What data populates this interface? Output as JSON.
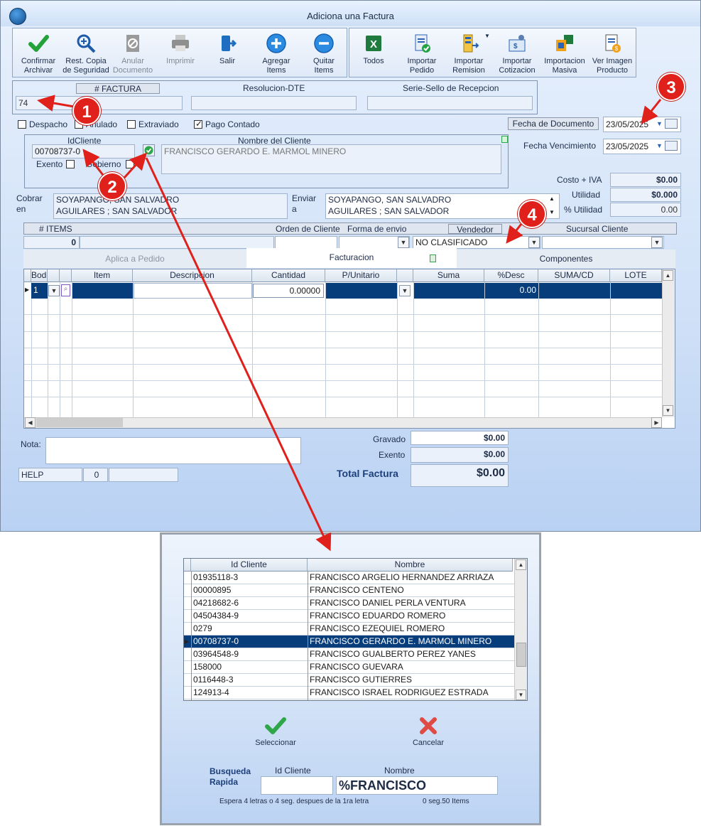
{
  "window": {
    "title": "Adiciona una Factura"
  },
  "toolbar": {
    "left": [
      {
        "label": "Confirmar\nArchivar",
        "icon": "checkmark-icon"
      },
      {
        "label": "Rest. Copia\nde Seguridad",
        "icon": "magnify-icon"
      },
      {
        "label": "Anular\nDocumento",
        "icon": "cancel-document-icon"
      },
      {
        "label": "Imprimir",
        "icon": "printer-icon"
      },
      {
        "label": "Salir",
        "icon": "exit-icon"
      },
      {
        "label": "Agregar\nItems",
        "icon": "plus-circle-icon"
      },
      {
        "label": "Quitar\nItems",
        "icon": "minus-circle-icon"
      }
    ],
    "right": [
      {
        "label": "Todos",
        "icon": "excel-icon"
      },
      {
        "label": "Importar\nPedido",
        "icon": "import-order-icon"
      },
      {
        "label": "Importar\nRemision",
        "icon": "import-remission-icon"
      },
      {
        "label": "Importar\nCotizacion",
        "icon": "import-quote-icon"
      },
      {
        "label": "Importacion\nMasiva",
        "icon": "mass-import-icon"
      },
      {
        "label": "Ver Imagen\nProducto",
        "icon": "product-image-icon"
      }
    ]
  },
  "header": {
    "factura_label": "# FACTURA",
    "factura_value": "74",
    "resolucion_label": "Resolucion-DTE",
    "serie_label": "Serie-Sello de Recepcion"
  },
  "flags": {
    "despacho": "Despacho",
    "anulado": "Anulado",
    "extraviado": "Extraviado",
    "pago_contado": "Pago Contado",
    "pago_contado_checked": true
  },
  "dates": {
    "fecha_doc_label": "Fecha de  Documento",
    "fecha_doc_value": "23/05/2025",
    "fecha_venc_label": "Fecha Vencimiento",
    "fecha_venc_value": "23/05/2025"
  },
  "cliente": {
    "id_label": "IdCliente",
    "id_value": "00708737-0",
    "nombre_label": "Nombre del Cliente",
    "nombre_value": "FRANCISCO GERARDO E. MARMOL MINERO",
    "exento_label": "Exento",
    "gobierno_label": "Gobierno"
  },
  "totales_top": {
    "costo_label": "Costo + IVA",
    "costo_value": "$0.00",
    "utilidad_label": "Utilidad",
    "utilidad_value": "$0.000",
    "putilidad_label": "% Utilidad",
    "putilidad_value": "0.00"
  },
  "direcciones": {
    "cobrar_label": "Cobrar\nen",
    "cobrar_line1": "SOYAPANGO, SAN SALVADRO",
    "cobrar_line2": "AGUILARES ; SAN SALVADOR",
    "enviar_label": "Enviar\na",
    "enviar_line1": "SOYAPANGO, SAN SALVADRO",
    "enviar_line2": "AGUILARES ; SAN SALVADOR"
  },
  "items_bar": {
    "items_label": "# ITEMS",
    "items_value": "0",
    "orden_label": "Orden de Cliente",
    "forma_label": "Forma de envio",
    "vendedor_label": "Vendedor",
    "vendedor_value": "NO CLASIFICADO",
    "sucursal_label": "Sucursal Cliente"
  },
  "tabs": [
    "Aplica a Pedido",
    "Facturacion",
    "Componentes"
  ],
  "grid": {
    "columns": [
      "Bodega",
      "",
      "Item",
      "Descripcion",
      "Cantidad",
      "P/Unitario",
      "",
      "Suma",
      "%Desc",
      "SUMA/CD",
      "LOTE"
    ],
    "row": {
      "bodega": "1",
      "cantidad": "0.00000",
      "desc": "0.00"
    }
  },
  "bottom": {
    "nota_label": "Nota:",
    "gravado_label": "Gravado",
    "gravado_value": "$0.00",
    "exento_label": "Exento",
    "exento_value": "$0.00",
    "total_label": "Total Factura",
    "total_value": "$0.00",
    "help_label": "HELP",
    "help_value": "0"
  },
  "annotations": [
    "1",
    "2",
    "3",
    "4"
  ],
  "dialog": {
    "col_id": "Id Cliente",
    "col_nombre": "Nombre",
    "rows": [
      {
        "id": "01935118-3",
        "nombre": "FRANCISCO ARGELIO HERNANDEZ ARRIAZA"
      },
      {
        "id": "00000895",
        "nombre": "FRANCISCO CENTENO"
      },
      {
        "id": "04218682-6",
        "nombre": "FRANCISCO DANIEL PERLA VENTURA"
      },
      {
        "id": "04504384-9",
        "nombre": "FRANCISCO EDUARDO ROMERO"
      },
      {
        "id": "0279",
        "nombre": "FRANCISCO EZEQUIEL ROMERO"
      },
      {
        "id": "00708737-0",
        "nombre": "FRANCISCO GERARDO E. MARMOL MINERO"
      },
      {
        "id": "03964548-9",
        "nombre": "FRANCISCO GUALBERTO PEREZ YANES"
      },
      {
        "id": "158000",
        "nombre": "FRANCISCO GUEVARA"
      },
      {
        "id": "0116448-3",
        "nombre": "FRANCISCO GUTIERRES"
      },
      {
        "id": "124913-4",
        "nombre": "FRANCISCO ISRAEL RODRIGUEZ ESTRADA"
      }
    ],
    "selected_index": 5,
    "seleccionar_label": "Seleccionar",
    "cancelar_label": "Cancelar",
    "busqueda_label": "Busqueda\nRapida",
    "search_id_label": "Id Cliente",
    "search_nombre_label": "Nombre",
    "search_value": "%FRANCISCO",
    "hint": "Espera 4 letras o 4 seg. despues de la 1ra letra",
    "stats": "0 seg.50 Items"
  }
}
